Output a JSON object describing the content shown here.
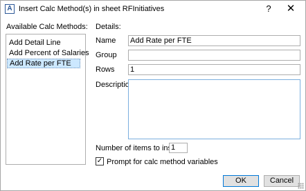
{
  "window": {
    "icon_glyph": "A",
    "title": "Insert Calc Method(s) in sheet RFInitiatives",
    "help_glyph": "?",
    "close_glyph": "✕"
  },
  "left_panel": {
    "heading": "Available Calc Methods:",
    "items": [
      {
        "label": "Add Detail Line",
        "selected": false
      },
      {
        "label": "Add Percent of Salaries",
        "selected": false
      },
      {
        "label": "Add Rate per FTE",
        "selected": true
      }
    ]
  },
  "details": {
    "heading": "Details:",
    "name_label": "Name",
    "name_value": "Add Rate per FTE",
    "group_label": "Group",
    "group_value": "",
    "rows_label": "Rows",
    "rows_value": "1",
    "description_label": "Description",
    "description_value": ""
  },
  "options": {
    "items_to_insert_label": "Number of items to insert:",
    "items_to_insert_value": "1",
    "prompt_label": "Prompt for calc method variables",
    "prompt_checked": true,
    "check_glyph": "✓"
  },
  "buttons": {
    "ok": "OK",
    "cancel": "Cancel"
  },
  "icons": {
    "app": "app-logo-icon",
    "help": "help-icon",
    "close": "close-icon",
    "check": "checkmark-icon",
    "grip": "resize-grip-icon"
  },
  "colors": {
    "selection_background": "#cce8ff",
    "focus_border": "#0078d7",
    "button_face": "#e1e1e1"
  }
}
